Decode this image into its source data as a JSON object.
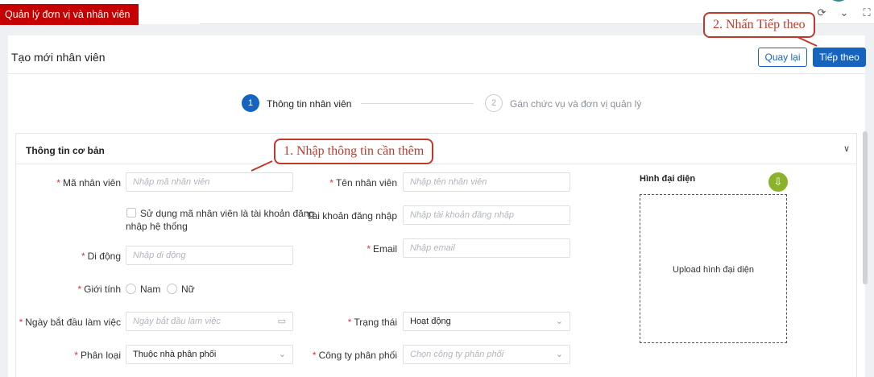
{
  "app": {
    "banner": "Quản lý đơn vị và nhân viên"
  },
  "page": {
    "title": "Tạo mới nhân viên",
    "back_label": "Quay lại",
    "next_label": "Tiếp theo"
  },
  "steps": [
    {
      "number": "1",
      "label": "Thông tin nhân viên"
    },
    {
      "number": "2",
      "label": "Gán chức vụ và đơn vị quản lý"
    }
  ],
  "section": {
    "title": "Thông tin cơ bản"
  },
  "form": {
    "employee_code": {
      "label": "Mã nhân viên",
      "placeholder": "Nhập mã nhân viên"
    },
    "use_code_account": {
      "label_line1": "Sử dụng mã nhân viên là tài khoản đăng",
      "label_line2": "nhập hệ thống"
    },
    "mobile": {
      "label": "Di động",
      "placeholder": "Nhập di động"
    },
    "gender": {
      "label": "Giới tính",
      "options": [
        "Nam",
        "Nữ"
      ]
    },
    "start_date": {
      "label": "Ngày bắt đầu làm việc",
      "placeholder": "Ngày bắt đầu làm việc"
    },
    "category": {
      "label": "Phân loại",
      "value": "Thuộc nhà phân phối"
    },
    "employee_name": {
      "label": "Tên nhân viên",
      "placeholder": "Nhập tên nhân viên"
    },
    "login_account": {
      "label": "Tài khoản đăng nhập",
      "placeholder": "Nhập tài khoản đăng nhập"
    },
    "email": {
      "label": "Email",
      "placeholder": "Nhập email"
    },
    "status": {
      "label": "Trạng thái",
      "value": "Hoạt động"
    },
    "distributor": {
      "label": "Công ty phân phối",
      "placeholder": "Chọn công ty phân phối"
    }
  },
  "avatar": {
    "label": "Hình đại diện",
    "upload_text": "Upload hình đại diện"
  },
  "annotations": {
    "step1": "1. Nhập thông tin cần thêm",
    "step2": "2. Nhấn Tiếp theo"
  },
  "colors": {
    "primary": "#1565c0",
    "banner": "#c40000",
    "callout": "#c0392b",
    "upload": "#8ab32b"
  }
}
